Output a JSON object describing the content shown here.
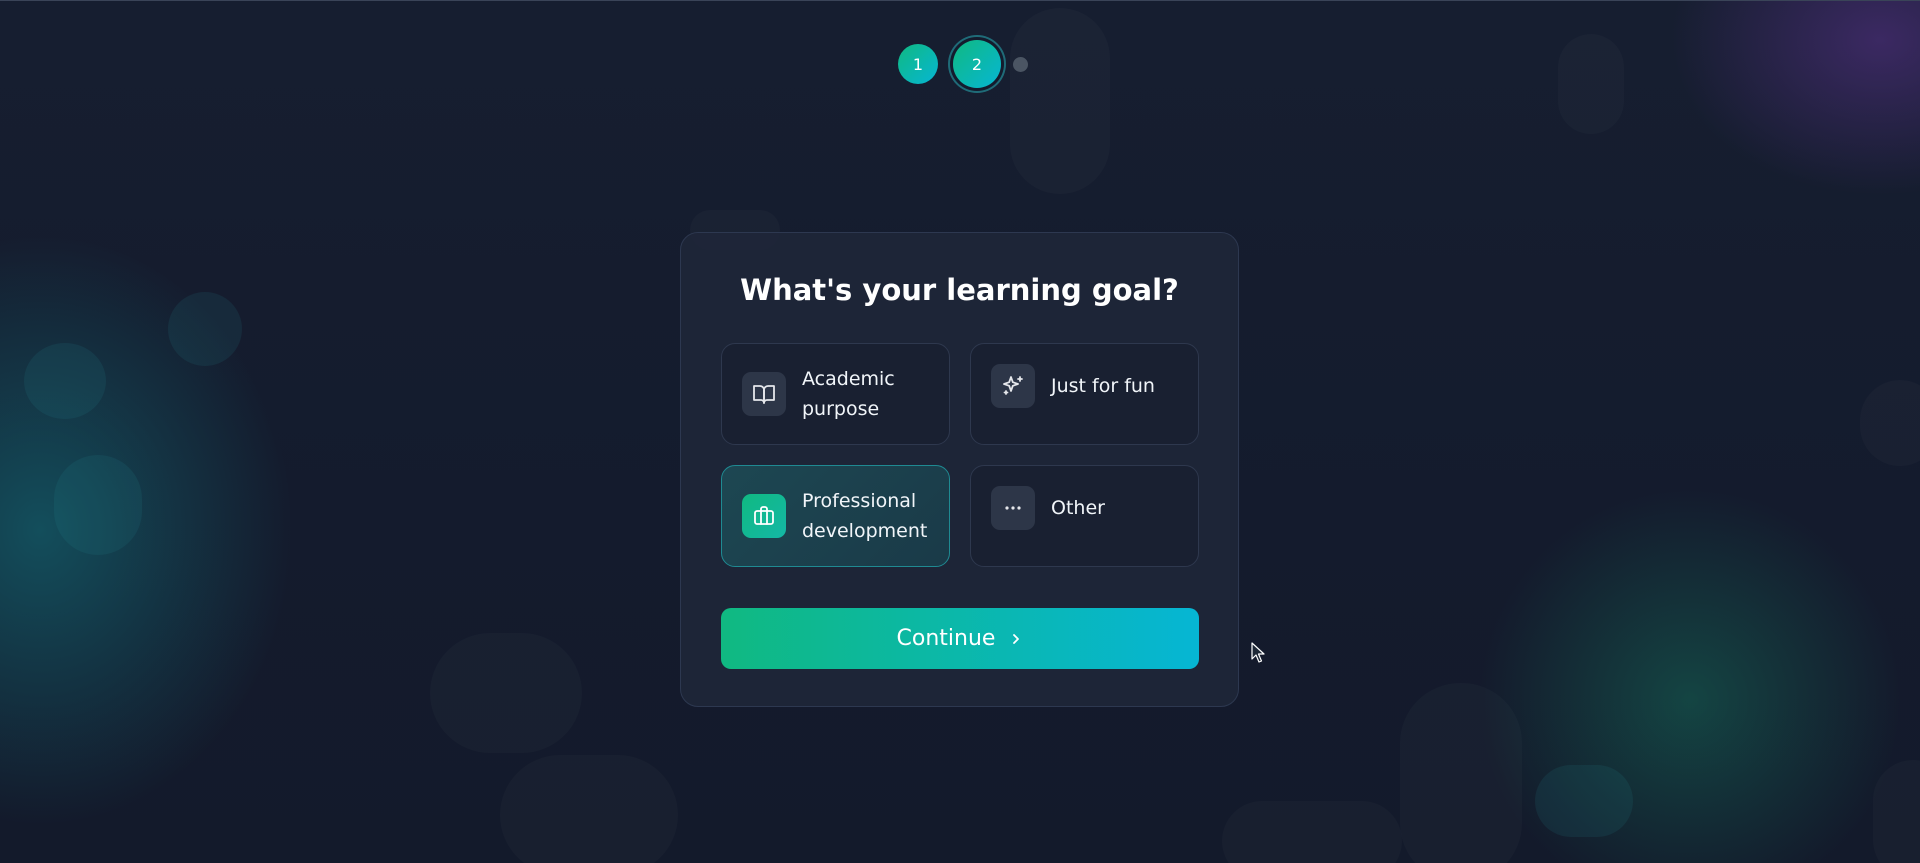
{
  "stepper": {
    "steps": [
      {
        "label": "1",
        "state": "complete"
      },
      {
        "label": "2",
        "state": "current"
      },
      {
        "label": "",
        "state": "upcoming"
      }
    ]
  },
  "card": {
    "title": "What's your learning goal?",
    "options": [
      {
        "label": "Academic purpose",
        "icon": "book-icon",
        "selected": false
      },
      {
        "label": "Just for fun",
        "icon": "sparkle-icon",
        "selected": false
      },
      {
        "label": "Professional development",
        "icon": "briefcase-icon",
        "selected": true
      },
      {
        "label": "Other",
        "icon": "more-dots-icon",
        "selected": false
      }
    ],
    "continue_label": "Continue"
  },
  "colors": {
    "background": "#141b2d",
    "card": "#1e2638",
    "accent_start": "#10b981",
    "accent_end": "#06b6d4",
    "selected_border": "#1f8a92"
  }
}
